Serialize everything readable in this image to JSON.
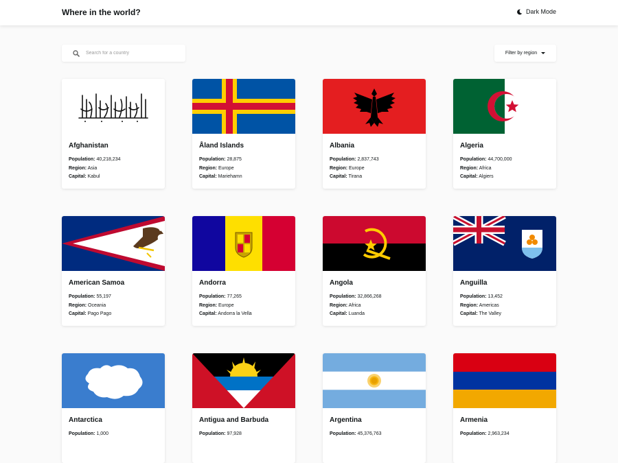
{
  "header": {
    "title": "Where in the world?",
    "dark_mode_label": "Dark Mode"
  },
  "search": {
    "placeholder": "Search for a country",
    "value": ""
  },
  "filter": {
    "label": "Filter by region"
  },
  "labels": {
    "population": "Population:",
    "region": "Region:",
    "capital": "Capital:"
  },
  "countries": [
    {
      "name": "Afghanistan",
      "population": "40,218,234",
      "region": "Asia",
      "capital": "Kabul",
      "flag": "afghanistan-flag"
    },
    {
      "name": "Åland Islands",
      "population": "28,875",
      "region": "Europe",
      "capital": "Mariehamn",
      "flag": "aland-flag"
    },
    {
      "name": "Albania",
      "population": "2,837,743",
      "region": "Europe",
      "capital": "Tirana",
      "flag": "albania-flag"
    },
    {
      "name": "Algeria",
      "population": "44,700,000",
      "region": "Africa",
      "capital": "Algiers",
      "flag": "algeria-flag"
    },
    {
      "name": "American Samoa",
      "population": "55,197",
      "region": "Oceania",
      "capital": "Pago Pago",
      "flag": "american-samoa-flag"
    },
    {
      "name": "Andorra",
      "population": "77,265",
      "region": "Europe",
      "capital": "Andorra la Vella",
      "flag": "andorra-flag"
    },
    {
      "name": "Angola",
      "population": "32,866,268",
      "region": "Africa",
      "capital": "Luanda",
      "flag": "angola-flag"
    },
    {
      "name": "Anguilla",
      "population": "13,452",
      "region": "Americas",
      "capital": "The Valley",
      "flag": "anguilla-flag"
    },
    {
      "name": "Antarctica",
      "population": "1,000",
      "region": "",
      "capital": "",
      "flag": "antarctica-flag"
    },
    {
      "name": "Antigua and Barbuda",
      "population": "97,928",
      "region": "",
      "capital": "",
      "flag": "antigua-flag"
    },
    {
      "name": "Argentina",
      "population": "45,376,763",
      "region": "",
      "capital": "",
      "flag": "argentina-flag"
    },
    {
      "name": "Armenia",
      "population": "2,963,234",
      "region": "",
      "capital": "",
      "flag": "armenia-flag"
    }
  ],
  "colors": {
    "background": "#fafafa",
    "card": "#ffffff",
    "text": "#111517"
  }
}
